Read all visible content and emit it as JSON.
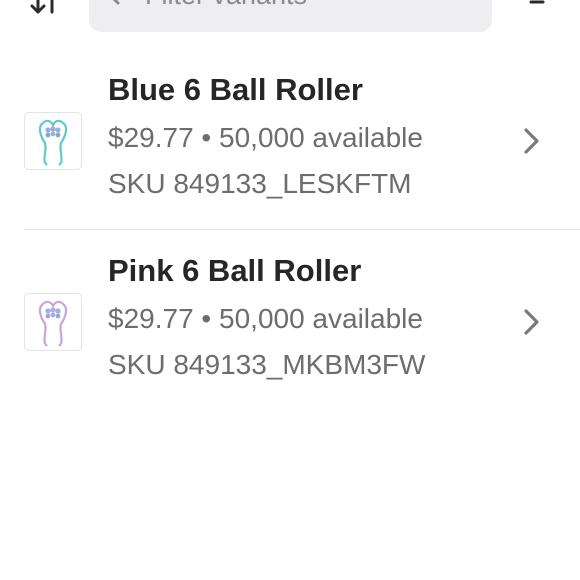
{
  "toolbar": {
    "sort_icon": "sort-arrows-icon",
    "search_placeholder": "Filter variants",
    "search_value": "",
    "filter_icon": "filter-lines-icon"
  },
  "variants": [
    {
      "title": "Blue 6 Ball Roller",
      "price": "$29.77",
      "separator": "•",
      "availability": "50,000 available",
      "sku": "SKU 849133_LESKFTM",
      "thumb_color": "#5fc8cf"
    },
    {
      "title": "Pink 6 Ball Roller",
      "price": "$29.77",
      "separator": "•",
      "availability": "50,000 available",
      "sku": "SKU 849133_MKBM3FW",
      "thumb_color": "#c7a5d6"
    }
  ],
  "colors": {
    "search_bg": "#eeeef0",
    "text_primary": "#262626",
    "text_secondary": "#6d6d6d",
    "chevron": "#7a7a7a"
  }
}
